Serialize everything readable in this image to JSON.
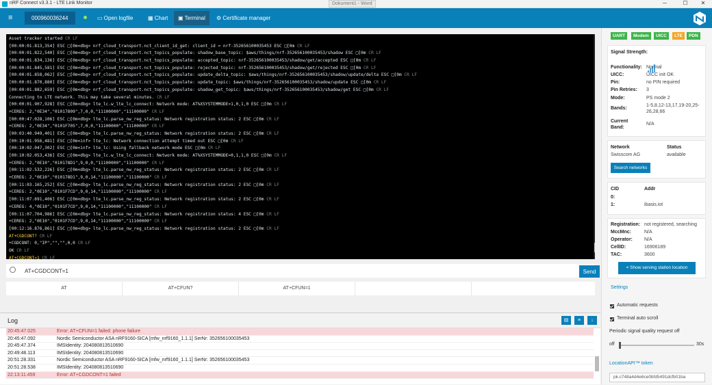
{
  "window": {
    "title": "nRF Connect v3.3.1 - LTE Link Monitor",
    "background_doc": "Dokument1 - Word",
    "min": "─",
    "max": "☐",
    "close": "✕"
  },
  "toolbar": {
    "menu_icon": "≡",
    "serial": "000960036244",
    "open_logfile": "Open logfile",
    "chart": "Chart",
    "terminal": "Terminal",
    "certificate_manager": "Certificate manager",
    "accent": "#0a80b9"
  },
  "terminal": {
    "lines": [
      {
        "kind": "",
        "text": "Asset tracker started"
      },
      {
        "kind": "",
        "text": "[00:00:01.813,354] ESC □[0m<dbg> nrf_cloud_transport.nct_client_id_get: client_id = nrf-352656100035453 ESC □[0m"
      },
      {
        "kind": "",
        "text": "[00:00:01.822,540] ESC □[0m<dbg> nrf_cloud_transport.nct_topics_populate: shadow_base_topic: $aws/things/nrf-352656100035453/shadow ESC □[0m"
      },
      {
        "kind": "",
        "text": "[00:00:01.834,136] ESC □[0m<dbg> nrf_cloud_transport.nct_topics_populate: accepted_topic: nrf-352656100035453/shadow/get/accepted ESC □[0m"
      },
      {
        "kind": "",
        "text": "[00:00:01.845,581] ESC □[0m<dbg> nrf_cloud_transport.nct_topics_populate: rejected_topic: nrf-352656100035453/shadow/get/rejected ESC □[0m"
      },
      {
        "kind": "",
        "text": "[00:00:01.858,062] ESC □[0m<dbg> nrf_cloud_transport.nct_topics_populate: update_delta_topic: $aws/things/nrf-352656100035453/shadow/update/delta ESC □[0m"
      },
      {
        "kind": "",
        "text": "[00:00:01.870,880] ESC □[0m<dbg> nrf_cloud_transport.nct_topics_populate: update_topic: $aws/things/nrf-352656100035453/shadow/update ESC □[0m"
      },
      {
        "kind": "",
        "text": "[00:00:01.882,659] ESC □[0m<dbg> nrf_cloud_transport.nct_topics_populate: shadow_get_topic: $aws/things/nrf-352656100035453/shadow/get ESC □[0m"
      },
      {
        "kind": "",
        "text": "Connecting to LTE network. This may take several minutes."
      },
      {
        "kind": "",
        "text": "[00:00:01.907,928] ESC □[0m<dbg> lte_lc.w_lte_lc_connect: Network mode: AT%XSYSTEMMODE=1,0,1,0 ESC □[0m"
      },
      {
        "kind": "",
        "text": "+CEREG: 2,\"0E34\",\"01017809\",7,0,0,\"11100000\",\"11100000\""
      },
      {
        "kind": "",
        "text": "[00:00:47.028,106] ESC □[0m<dbg> lte_lc.parse_nw_reg_status: Network registration status: 2 ESC □[0m"
      },
      {
        "kind": "",
        "text": "+CEREG: 2,\"0E34\",\"0101F705\",7,0,0,\"11100000\",\"11100000\""
      },
      {
        "kind": "",
        "text": "[00:03:40.949,401] ESC □[0m<dbg> lte_lc.parse_nw_reg_status: Network registration status: 2 ESC □[0m"
      },
      {
        "kind": "",
        "text": "[00:10:01.956,481] ESC □[0m<inf> lte_lc: Network connection attempt timed out ESC □[0m"
      },
      {
        "kind": "",
        "text": "[00:10:02.047,302] ESC □[0m<inf> lte_lc: Using fallback network mode ESC □[0m"
      },
      {
        "kind": "",
        "text": "[00:10:02.053,436] ESC □[0m<dbg> lte_lc.w_lte_lc_connect: Network mode: AT%XSYSTEMMODE=0,1,1,0 ESC □[0m"
      },
      {
        "kind": "",
        "text": "+CEREG: 2,\"0E10\",\"010178D1\",9,0,0,\"11100000\",\"11100000\""
      },
      {
        "kind": "",
        "text": "[00:11:02.532,226] ESC □[0m<dbg> lte_lc.parse_nw_reg_status: Network registration status: 2 ESC □[0m"
      },
      {
        "kind": "",
        "text": "+CEREG: 2,\"0E10\",\"010178D1\",9,0,14,\"11100000\",\"11100000\""
      },
      {
        "kind": "",
        "text": "[00:11:03.165,252] ESC □[0m<dbg> lte_lc.parse_nw_reg_status: Network registration status: 2 ESC □[0m"
      },
      {
        "kind": "",
        "text": "+CEREG: 2,\"0E10\",\"0101F7CD\",9,0,14,\"11100000\",\"11100000\""
      },
      {
        "kind": "",
        "text": "[00:11:07.691,406] ESC □[0m<dbg> lte_lc.parse_nw_reg_status: Network registration status: 2 ESC □[0m"
      },
      {
        "kind": "",
        "text": "+CEREG: 4,\"0E10\",\"0101F7CD\",9,0,14,\"11100000\",\"11100000\""
      },
      {
        "kind": "",
        "text": "[00:11:07.704,986] ESC □[0m<dbg> lte_lc.parse_nw_reg_status: Network registration status: 4 ESC □[0m"
      },
      {
        "kind": "",
        "text": "+CEREG: 2,\"0E10\",\"0101F7CD\",9,0,14,\"11100000\",\"11100000\""
      },
      {
        "kind": "",
        "text": "[00:12:16.876,861] ESC □[0m<dbg> lte_lc.parse_nw_reg_status: Network registration status: 2 ESC □[0m"
      },
      {
        "kind": "ok",
        "text": "AT+CGDCONT?"
      },
      {
        "kind": "",
        "text": "+CGDCONT: 0,\"IP\",\"\",\"\",0,0"
      },
      {
        "kind": "",
        "text": "OK"
      },
      {
        "kind": "ok",
        "text": "AT+CGDCONT=1"
      },
      {
        "kind": "",
        "text": "[00:13:17.741,912] ESC □[1;31m<err> at_host: Error while processing AT command: -8 ESC □[0m"
      },
      {
        "kind": "",
        "text": "ERROR"
      }
    ],
    "crlf": "CR LF"
  },
  "input": {
    "value": "AT+CGDCONT=1",
    "send": "Send"
  },
  "quick_commands": [
    "AT",
    "AT+CFUN?",
    "AT+CFUN=1",
    "",
    ""
  ],
  "log": {
    "title": "Log",
    "rows": [
      {
        "ts": "20:45:47.025",
        "msg": "Error: AT+CFUN=1 failed: phone failure",
        "err": true
      },
      {
        "ts": "20:45:47.092",
        "msg": "Nordic Semiconductor ASA nRF9160-SICA [mfw_nrf9160_1.1.1] SerNr: 352656100035453",
        "err": false
      },
      {
        "ts": "20:45:47.374",
        "msg": "IMSIdentity: 204080813510690",
        "err": false
      },
      {
        "ts": "20:49:48.113",
        "msg": "IMSIdentity: 204080813510690",
        "err": false
      },
      {
        "ts": "20:51:28.331",
        "msg": "Nordic Semiconductor ASA nRF9160-SICA [mfw_nrf9160_1.1.1] SerNr: 352656100035453",
        "err": false
      },
      {
        "ts": "20:51:28.538",
        "msg": "IMSIdentity: 204080813510690",
        "err": false
      },
      {
        "ts": "22:13:11.459",
        "msg": "Error: AT+CGDCONT=1 failed",
        "err": true
      }
    ]
  },
  "sidebar": {
    "badges": [
      "UART",
      "Modem",
      "UICC",
      "LTE",
      "PDN"
    ],
    "status": {
      "signal_strength_label": "Signal Strength:",
      "functionality_label": "Functionality:",
      "functionality": "Normal",
      "uicc_label": "UICC:",
      "uicc": "UICC init OK",
      "pin_label": "Pin:",
      "pin": "no PIN required",
      "pin_retries_label": "Pin Retries:",
      "pin_retries": "3",
      "mode_label": "Mode:",
      "mode": "PS mode 2",
      "bands_label": "Bands:",
      "bands": "1-5,8,12-13,17,19-20,25-26,28,66",
      "current_band_label": "Current Band:",
      "current_band": "N/A"
    },
    "network": {
      "network_label": "Network",
      "status_label": "Status",
      "network": "Swisscom AG",
      "status": "available",
      "search": "Search networks"
    },
    "pdp": {
      "cid_label": "CID",
      "addr_label": "Addr",
      "rows": [
        {
          "cid": "0:",
          "addr": ""
        },
        {
          "cid": "1:",
          "addr": "ibasis.iot"
        }
      ]
    },
    "registration": {
      "registration_label": "Registration:",
      "registration": "not registered, searching",
      "mccmnc_label": "MccMnc:",
      "mccmnc": "N/A",
      "operator_label": "Operator:",
      "operator": "N/A",
      "cellid_label": "CellID:",
      "cellid": "16906189",
      "tac_label": "TAC:",
      "tac": "3600",
      "show_location": "Show serving station location"
    },
    "settings": {
      "title": "Settings",
      "automatic_requests": "Automatic requests",
      "terminal_auto_scroll": "Terminal auto scroll",
      "periodic_label": "Periodic signal quality request off",
      "off": "off",
      "max": "30s",
      "location_api": "LocationAPI™ token",
      "token": "pk.c748a4d4e6ce0bfd5491dcfb01ba"
    }
  }
}
